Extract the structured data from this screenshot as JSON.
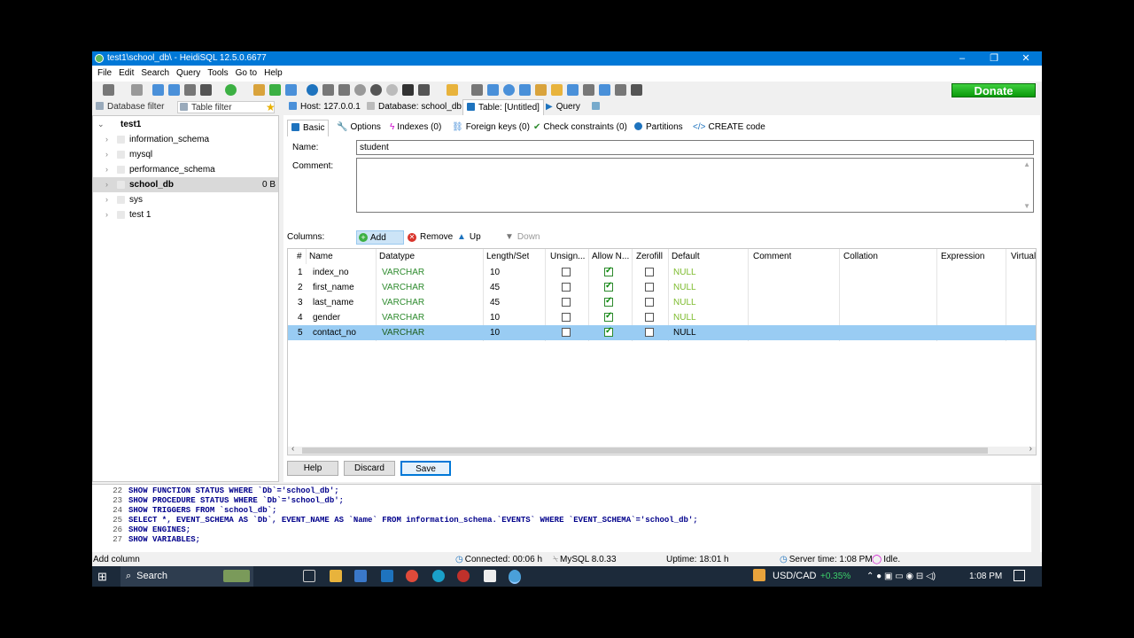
{
  "window": {
    "title": "test1\\school_db\\ - HeidiSQL 12.5.0.6677",
    "controls": {
      "minimize": "–",
      "restore": "❐",
      "close": "✕"
    }
  },
  "menu": [
    "File",
    "Edit",
    "Search",
    "Query",
    "Tools",
    "Go to",
    "Help"
  ],
  "toolbar": {
    "donate_label": "Donate"
  },
  "filters": {
    "database": "Database filter",
    "table": "Table filter"
  },
  "tree": {
    "root": "test1",
    "databases": [
      {
        "name": "information_schema",
        "size": ""
      },
      {
        "name": "mysql",
        "size": ""
      },
      {
        "name": "performance_schema",
        "size": ""
      },
      {
        "name": "school_db",
        "size": "0 B",
        "selected": true
      },
      {
        "name": "sys",
        "size": ""
      },
      {
        "name": "test 1",
        "size": ""
      }
    ]
  },
  "main_tabs": [
    {
      "label": "Host: 127.0.0.1",
      "icon": "host-icon"
    },
    {
      "label": "Database: school_db",
      "icon": "database-icon"
    },
    {
      "label": "Table: [Untitled]",
      "icon": "table-icon",
      "active": true
    },
    {
      "label": "Query",
      "icon": "play-icon"
    }
  ],
  "sub_tabs": [
    {
      "label": "Basic",
      "icon": "table-icon",
      "active": true
    },
    {
      "label": "Options",
      "icon": "wrench-icon"
    },
    {
      "label": "Indexes (0)",
      "icon": "lightning-icon"
    },
    {
      "label": "Foreign keys (0)",
      "icon": "link-icon"
    },
    {
      "label": "Check constraints (0)",
      "icon": "check-icon"
    },
    {
      "label": "Partitions",
      "icon": "pie-icon"
    },
    {
      "label": "CREATE code",
      "icon": "code-icon"
    }
  ],
  "form": {
    "name_label": "Name:",
    "name_value": "student",
    "comment_label": "Comment:",
    "comment_value": ""
  },
  "columns_toolbar": {
    "label": "Columns:",
    "add": "Add",
    "remove": "Remove",
    "up": "Up",
    "down": "Down"
  },
  "grid": {
    "headers": [
      "#",
      "Name",
      "Datatype",
      "Length/Set",
      "Unsign...",
      "Allow N...",
      "Zerofill",
      "Default",
      "Comment",
      "Collation",
      "Expression",
      "Virtuali"
    ],
    "rows": [
      {
        "num": "1",
        "name": "index_no",
        "datatype": "VARCHAR",
        "length": "10",
        "unsigned": false,
        "allow_null": true,
        "zerofill": false,
        "default": "NULL"
      },
      {
        "num": "2",
        "name": "first_name",
        "datatype": "VARCHAR",
        "length": "45",
        "unsigned": false,
        "allow_null": true,
        "zerofill": false,
        "default": "NULL"
      },
      {
        "num": "3",
        "name": "last_name",
        "datatype": "VARCHAR",
        "length": "45",
        "unsigned": false,
        "allow_null": true,
        "zerofill": false,
        "default": "NULL"
      },
      {
        "num": "4",
        "name": "gender",
        "datatype": "VARCHAR",
        "length": "10",
        "unsigned": false,
        "allow_null": true,
        "zerofill": false,
        "default": "NULL"
      },
      {
        "num": "5",
        "name": "contact_no",
        "datatype": "VARCHAR",
        "length": "10",
        "unsigned": false,
        "allow_null": true,
        "zerofill": false,
        "default": "NULL",
        "selected": true
      }
    ]
  },
  "buttons": {
    "help": "Help",
    "discard": "Discard",
    "save": "Save"
  },
  "sql_log": [
    {
      "n": "22",
      "text": "SHOW FUNCTION STATUS WHERE `Db`='school_db';"
    },
    {
      "n": "23",
      "text": "SHOW PROCEDURE STATUS WHERE `Db`='school_db';"
    },
    {
      "n": "24",
      "text": "SHOW TRIGGERS FROM `school_db`;"
    },
    {
      "n": "25",
      "text": "SELECT *, EVENT_SCHEMA AS `Db`, EVENT_NAME AS `Name` FROM information_schema.`EVENTS` WHERE `EVENT_SCHEMA`='school_db';"
    },
    {
      "n": "26",
      "text": "SHOW ENGINES;"
    },
    {
      "n": "27",
      "text": "SHOW VARIABLES;"
    }
  ],
  "status": {
    "hint": "Add column",
    "connected": "Connected: 00:06 h",
    "server": "MySQL 8.0.33",
    "uptime": "Uptime: 18:01 h",
    "server_time": "Server time: 1:08 PM",
    "state": "Idle."
  },
  "taskbar": {
    "search": "Search",
    "ticker": "USD/CAD",
    "ticker_change": "+0.35%",
    "clock": "1:08 PM"
  },
  "colors": {
    "titlebar": "#0078d7",
    "selection": "#99ccf3",
    "datatype_green": "#2e8b2e",
    "null_green": "#7cbb2c",
    "donate": "#12b812"
  }
}
